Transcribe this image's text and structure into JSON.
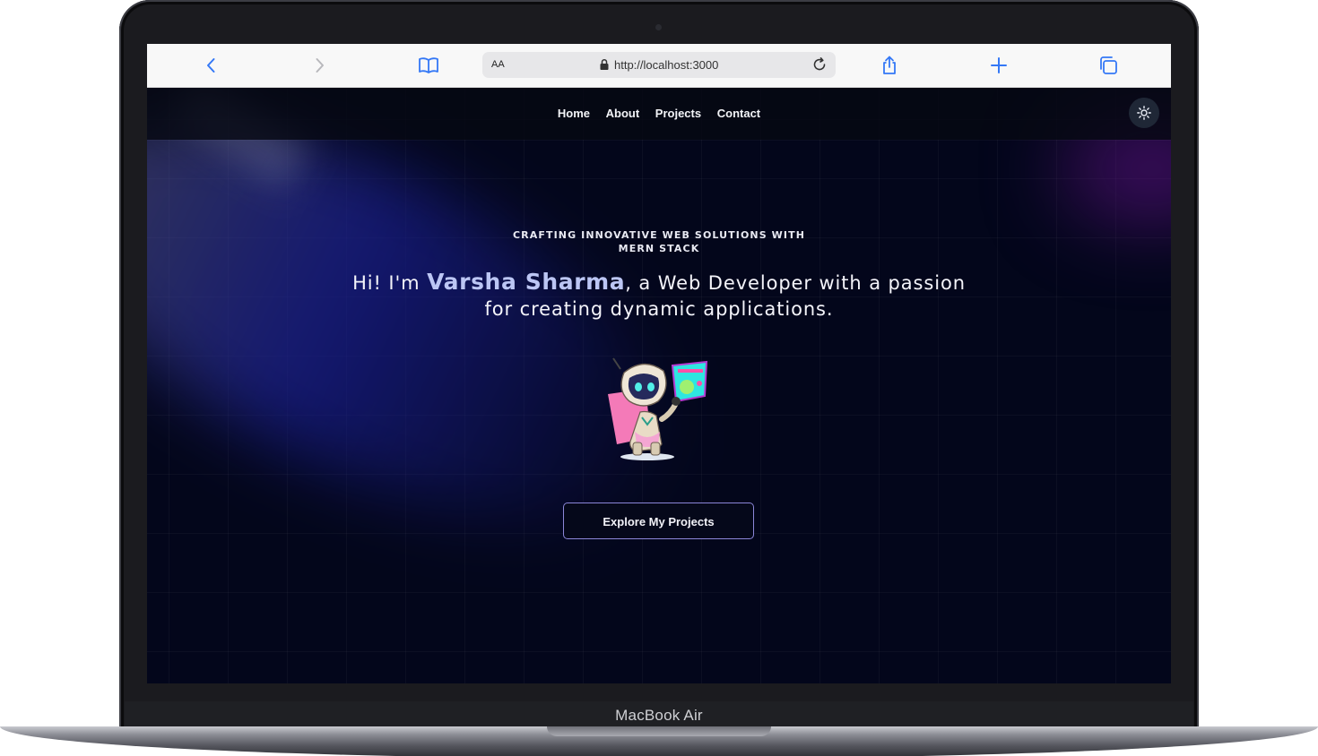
{
  "device": {
    "model_label": "MacBook Air"
  },
  "browser": {
    "text_size_label": "AA",
    "url": "http://localhost:3000",
    "icons": {
      "back": "chevron-left-icon",
      "forward": "chevron-right-icon",
      "bookmarks": "book-icon",
      "lock": "lock-icon",
      "reload": "reload-icon",
      "share": "share-icon",
      "new_tab": "plus-icon",
      "tabs": "tabs-icon"
    },
    "accent_color": "#3478f6"
  },
  "navbar": {
    "links": [
      "Home",
      "About",
      "Projects",
      "Contact"
    ],
    "theme_toggle_icon": "sun-icon"
  },
  "hero": {
    "tagline_line1": "CRAFTING INNOVATIVE WEB SOLUTIONS WITH",
    "tagline_line2": "MERN STACK",
    "headline_prefix": "Hi! I'm ",
    "name": "Varsha Sharma",
    "headline_suffix": ", a Web Developer with a passion",
    "headline_line2": "for creating dynamic applications.",
    "illustration_icon": "robot-developer-icon",
    "cta_label": "Explore My Projects"
  },
  "colors": {
    "page_background": "#03061b",
    "name_highlight": "#bcc6f4",
    "cta_border": "#8b86d8"
  }
}
